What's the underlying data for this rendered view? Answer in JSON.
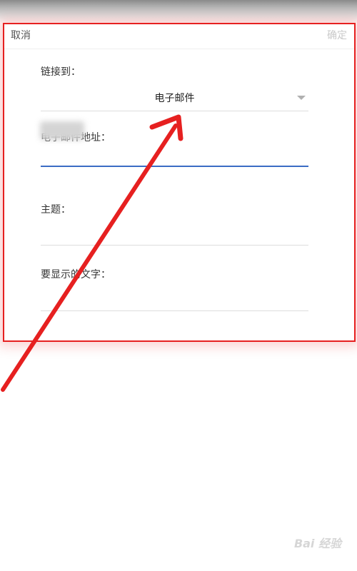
{
  "dialog": {
    "cancel_label": "取消",
    "confirm_label": "确定",
    "link_to_label": "链接到：",
    "link_type_value": "电子邮件",
    "email_address_label": "电子邮件地址：",
    "subject_label": "主题：",
    "display_text_label": "要显示的文字："
  },
  "annotation": {
    "color": "#e62020"
  },
  "watermark": {
    "text": "Bai 经验"
  },
  "colors": {
    "confirm_disabled": "#c9c9c9",
    "active_underline": "#3b6cc4"
  }
}
